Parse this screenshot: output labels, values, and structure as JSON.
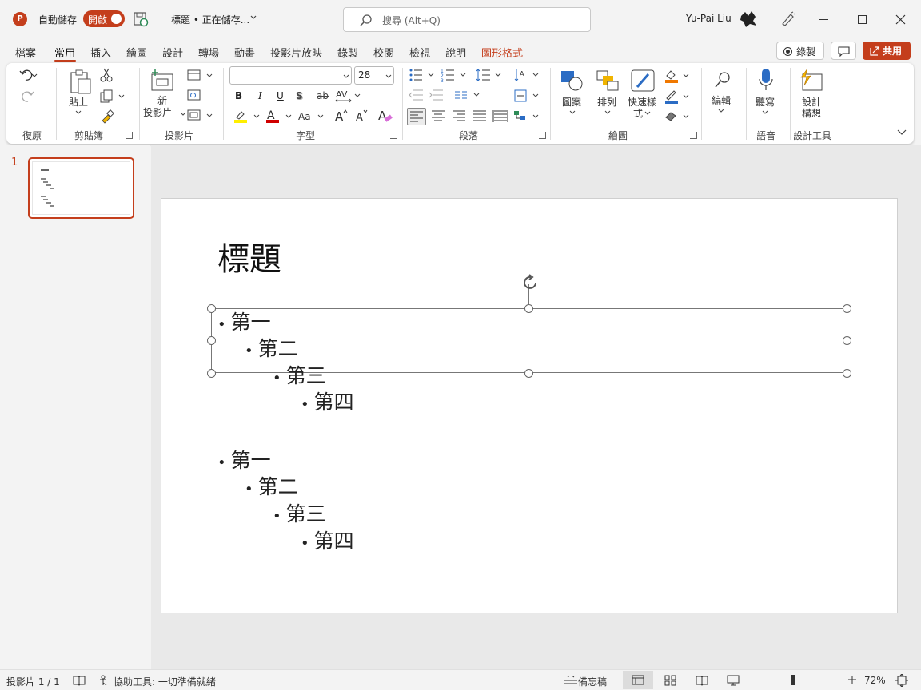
{
  "titlebar": {
    "autosave_label": "自動儲存",
    "autosave_toggle": "開啟",
    "doc_title": "標題 • 正在儲存...",
    "search_placeholder": "搜尋 (Alt+Q)",
    "user_name": "Yu-Pai Liu"
  },
  "menu": {
    "tabs": [
      "檔案",
      "常用",
      "插入",
      "繪圖",
      "設計",
      "轉場",
      "動畫",
      "投影片放映",
      "錄製",
      "校閱",
      "檢視",
      "說明",
      "圖形格式"
    ],
    "active_tab": "常用",
    "record_button": "錄製",
    "share_button": "共用"
  },
  "ribbon": {
    "groups": {
      "undo": "復原",
      "clipboard": "剪貼簿",
      "slides": "投影片",
      "font": "字型",
      "paragraph": "段落",
      "drawing": "繪圖",
      "voice": "語音",
      "designer": "設計工具"
    },
    "buttons": {
      "paste": "貼上",
      "new_slide_1": "新",
      "new_slide_2": "投影片",
      "shapes": "圖案",
      "arrange": "排列",
      "quick_styles_1": "快速樣",
      "quick_styles_2": "式",
      "editing": "編輯",
      "dictate": "聽寫",
      "designer_1": "設計",
      "designer_2": "構想"
    },
    "font_name": "",
    "font_size": "28",
    "font_format_labels": {
      "bold": "B",
      "italic": "I",
      "underline": "U",
      "shadow": "S",
      "strike": "ab",
      "case": "Aa"
    }
  },
  "thumbnails": [
    {
      "number": "1",
      "selected": true
    }
  ],
  "slide": {
    "title": "標題",
    "group1": [
      "第一",
      "第二",
      "第三",
      "第四"
    ],
    "group2": [
      "第一",
      "第二",
      "第三",
      "第四"
    ],
    "bullet": "•"
  },
  "statusbar": {
    "slide_counter": "投影片 1 / 1",
    "accessibility": "協助工具: 一切準備就緒",
    "notes": "備忘稿",
    "zoom": "72%",
    "zoom_level": 0.72
  },
  "colors": {
    "accent": "#c43e1c",
    "selected_tab_underline": "#c43e1c",
    "shape_format_tab": "#c43e1c"
  }
}
